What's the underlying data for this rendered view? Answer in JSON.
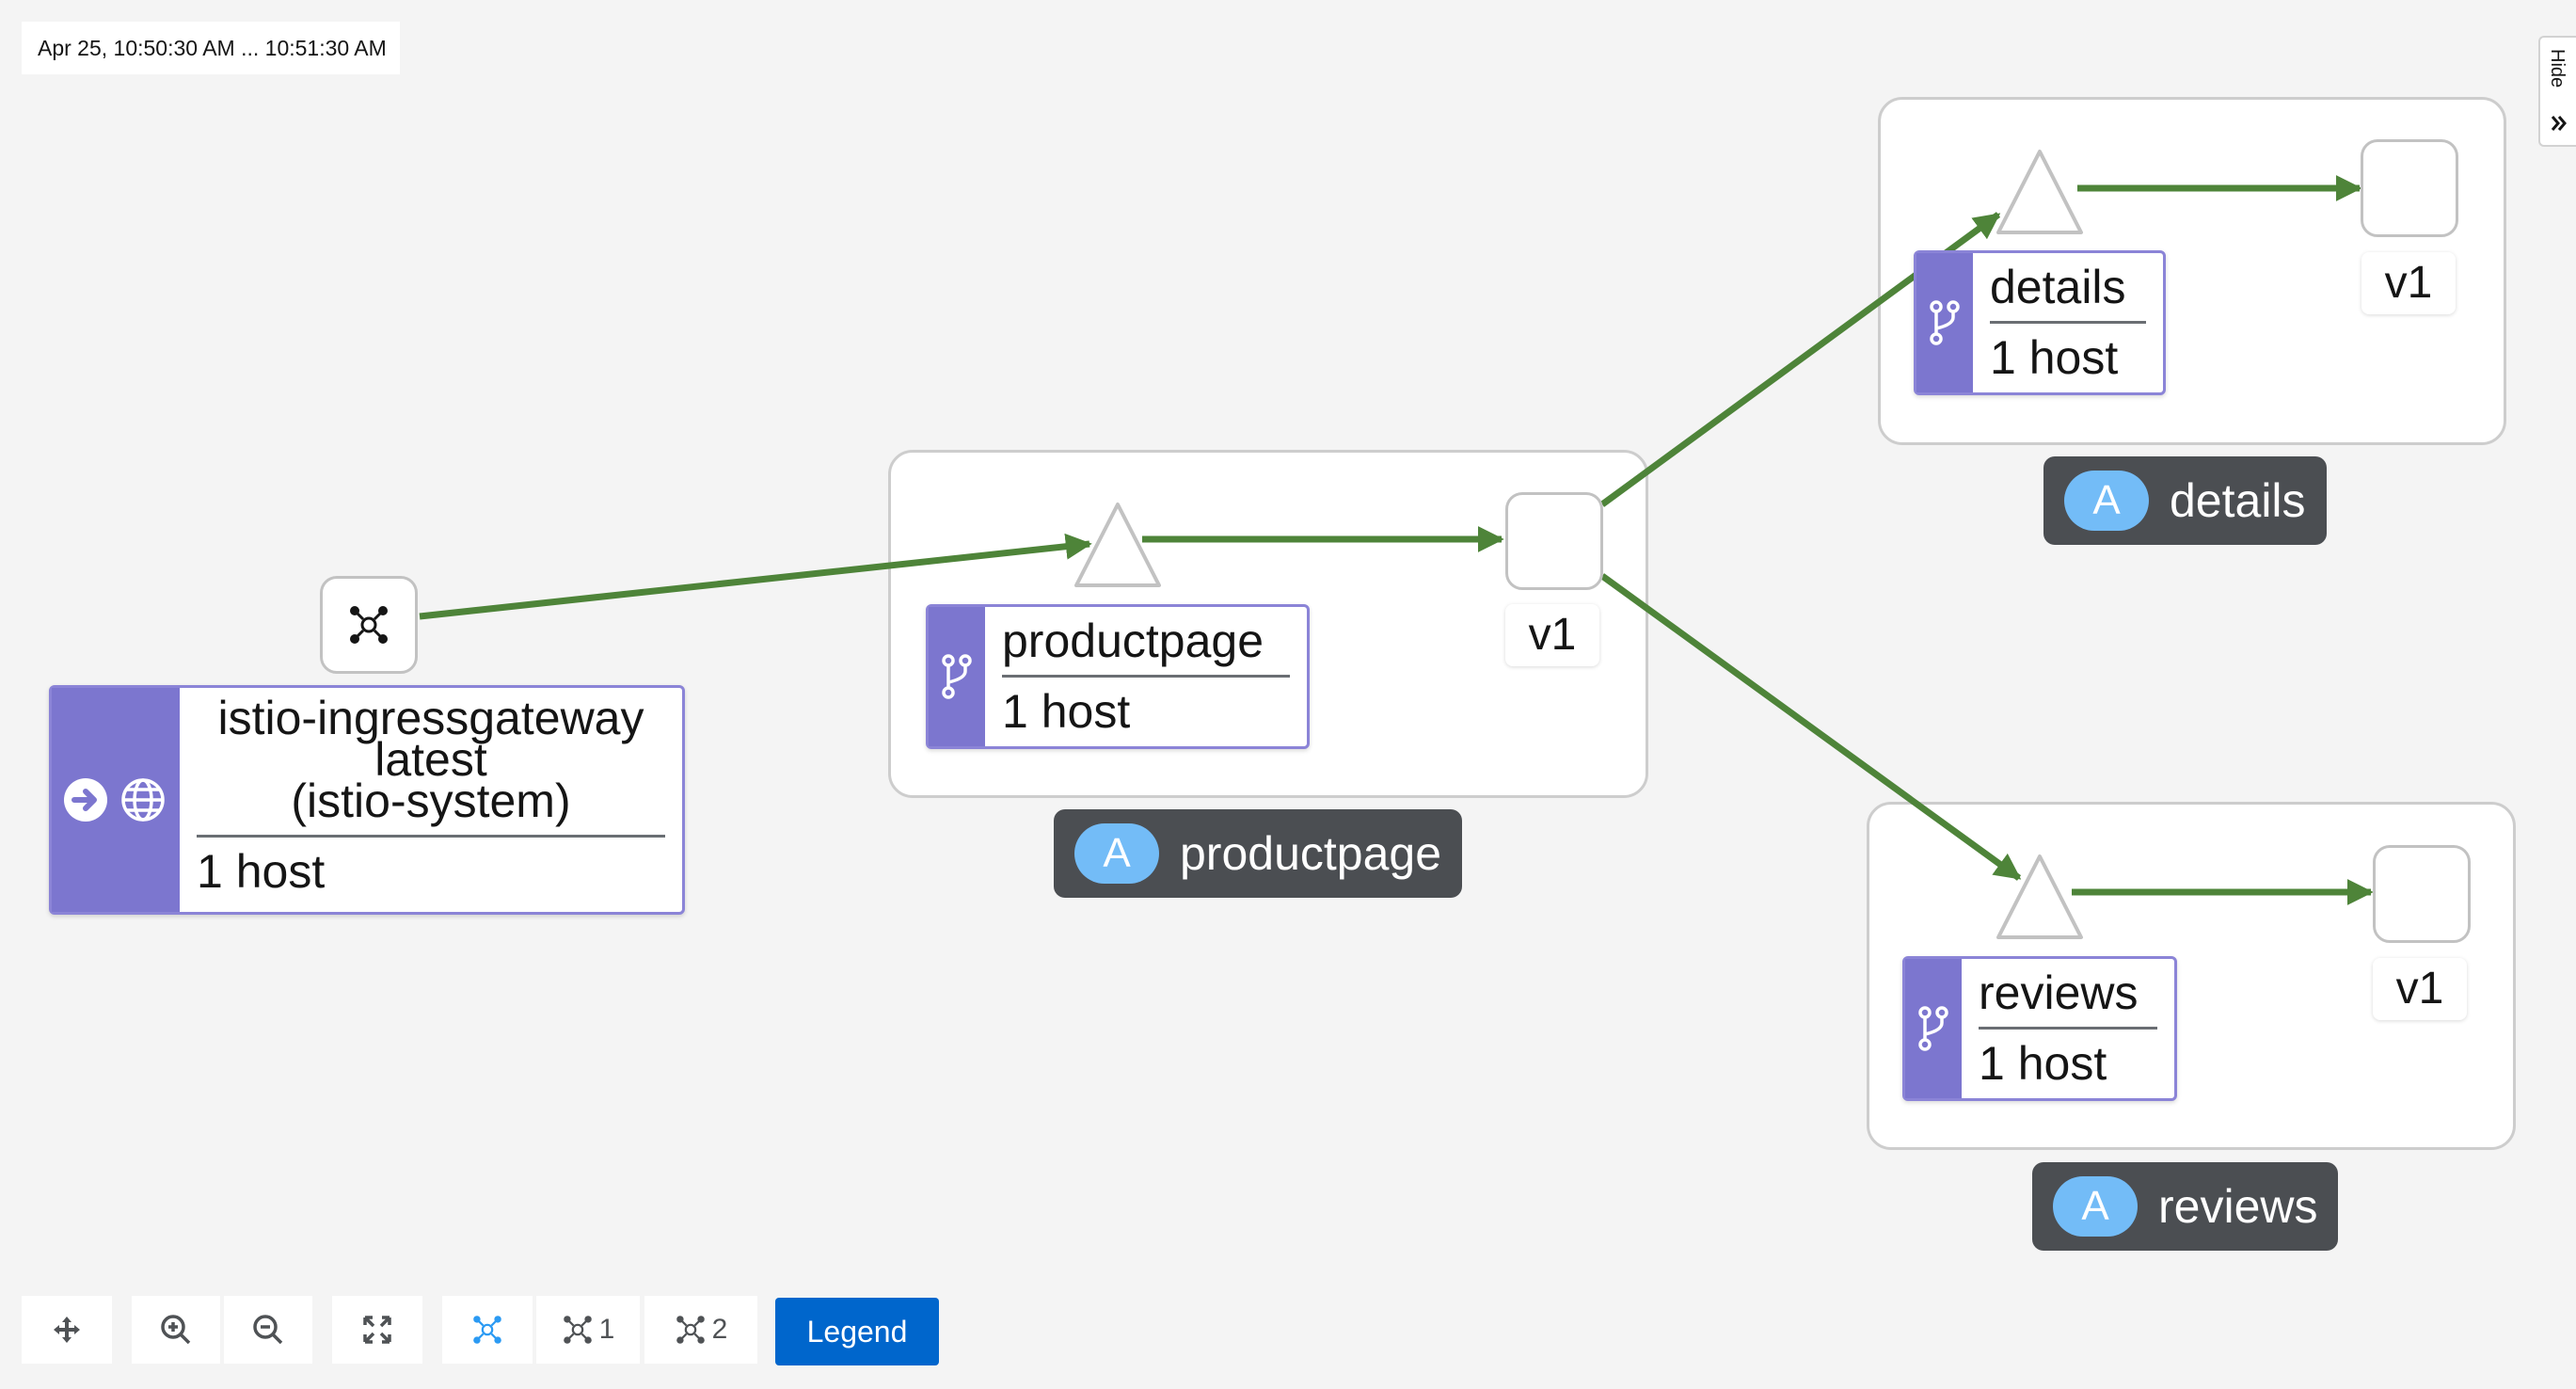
{
  "time_range": "Apr 25, 10:50:30 AM ... 10:51:30 AM",
  "side_panel": {
    "toggle_label": "Hide"
  },
  "graph": {
    "gateway": {
      "name_line1": "istio-ingressgateway",
      "name_line2": "latest",
      "namespace": "(istio-system)",
      "hosts": "1 host"
    },
    "apps": [
      {
        "id": "productpage",
        "badge_letter": "A",
        "badge_label": "productpage",
        "service_name": "productpage",
        "service_hosts": "1 host",
        "version_label": "v1"
      },
      {
        "id": "details",
        "badge_letter": "A",
        "badge_label": "details",
        "service_name": "details",
        "service_hosts": "1 host",
        "version_label": "v1"
      },
      {
        "id": "reviews",
        "badge_letter": "A",
        "badge_label": "reviews",
        "service_name": "reviews",
        "service_hosts": "1 host",
        "version_label": "v1"
      }
    ],
    "edge_color": "#4e8439",
    "node_border_color": "#c2c2c2",
    "service_accent": "#7c76cf",
    "badge_background": "#4b4e52",
    "badge_circle": "#73bcf7"
  },
  "toolbar": {
    "items": [
      {
        "name": "pan-button",
        "icon": "move-icon"
      },
      {
        "name": "zoom-in-button",
        "icon": "zoom-in-icon"
      },
      {
        "name": "zoom-out-button",
        "icon": "zoom-out-icon"
      },
      {
        "name": "fit-button",
        "icon": "expand-icon"
      },
      {
        "name": "layout-default-button",
        "icon": "topology-icon"
      },
      {
        "name": "layout-1-button",
        "icon": "topology-icon",
        "label": "1"
      },
      {
        "name": "layout-2-button",
        "icon": "topology-icon",
        "label": "2"
      }
    ],
    "legend_label": "Legend",
    "accent": "#0066cc"
  }
}
